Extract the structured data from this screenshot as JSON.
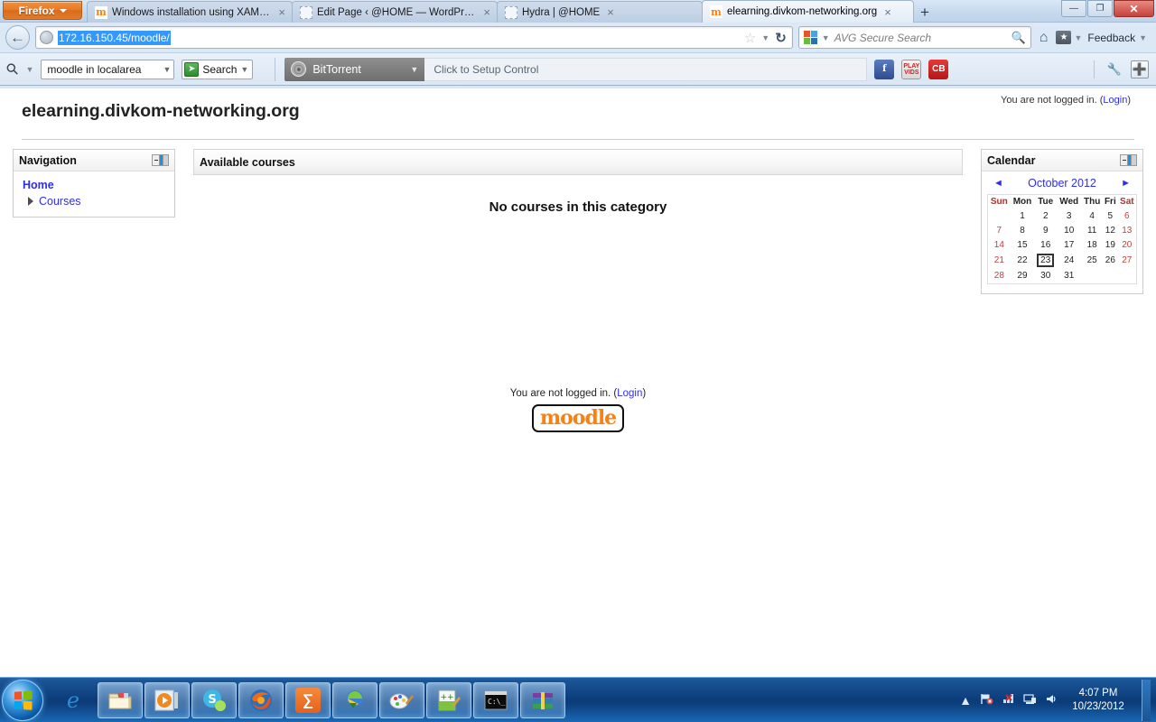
{
  "browser": {
    "app_button": "Firefox",
    "tabs": [
      {
        "label": "Windows installation using XAMPP - ...",
        "favicon": "moodle-favicon",
        "active": false,
        "close": "×"
      },
      {
        "label": "Edit Page ‹ @HOME — WordPress",
        "favicon": "blank-favicon",
        "active": false,
        "close": "×"
      },
      {
        "label": "Hydra | @HOME",
        "favicon": "blank-favicon",
        "active": false,
        "close": "×"
      },
      {
        "label": "elearning.divkom-networking.org",
        "favicon": "moodle-favicon",
        "active": true,
        "close": "×"
      }
    ],
    "new_tab_label": "+",
    "window_controls": {
      "minimize": "—",
      "restore": "❐",
      "close": "✕"
    },
    "url": "172.16.150.45/moodle/",
    "url_selected": true,
    "search": {
      "placeholder": "AVG Secure Search",
      "engine_icon": "avg-icon",
      "go_icon": "search-icon"
    },
    "home_label": "Home",
    "feedback_label": "Feedback",
    "back_icon": "back-arrow-icon",
    "reload_icon": "reload-icon",
    "star_icon": "bookmark-star-icon"
  },
  "addon_toolbar": {
    "avg_search_value": "moodle in localarea",
    "avg_search_button": "Search",
    "bittorrent_label": "BitTorrent",
    "bittorrent_setup_text": "Click to Setup Control",
    "buttons": [
      {
        "name": "facebook-button",
        "label": "f",
        "color": "#3b5998"
      },
      {
        "name": "playvids-button",
        "label": "PLAY VIDS",
        "color": "#d42a2a"
      },
      {
        "name": "cb-button",
        "label": "CB",
        "color": "#cc1f1f"
      }
    ],
    "tools": [
      {
        "name": "wrench-icon",
        "glyph": "🔧"
      },
      {
        "name": "plus-box-icon",
        "glyph": "+"
      }
    ]
  },
  "page": {
    "site_title": "elearning.divkom-networking.org",
    "login_notice_prefix": "You are not logged in. (",
    "login_link": "Login",
    "login_notice_suffix": ")",
    "navigation_block": {
      "title": "Navigation",
      "home": "Home",
      "courses": "Courses"
    },
    "main": {
      "courses_header": "Available courses",
      "no_courses_text": "No courses in this category"
    },
    "calendar_block": {
      "title": "Calendar",
      "prev_arrow": "◄",
      "next_arrow": "►",
      "month_label": "October 2012",
      "weekdays": [
        "Sun",
        "Mon",
        "Tue",
        "Wed",
        "Thu",
        "Fri",
        "Sat"
      ],
      "weeks": [
        [
          "",
          "1",
          "2",
          "3",
          "4",
          "5",
          "6"
        ],
        [
          "7",
          "8",
          "9",
          "10",
          "11",
          "12",
          "13"
        ],
        [
          "14",
          "15",
          "16",
          "17",
          "18",
          "19",
          "20"
        ],
        [
          "21",
          "22",
          "23",
          "24",
          "25",
          "26",
          "27"
        ],
        [
          "28",
          "29",
          "30",
          "31",
          "",
          "",
          ""
        ]
      ],
      "today": "23"
    },
    "footer": {
      "login_notice_prefix": "You are not logged in. (",
      "login_link": "Login",
      "login_notice_suffix": ")",
      "logo_text": "moodle"
    },
    "colors": {
      "link": "#2d2df1",
      "moodle_orange": "#f98012",
      "weekend": "#c04040"
    }
  },
  "taskbar": {
    "start_label": "Start",
    "items": [
      {
        "name": "taskbar-item-internet-explorer",
        "icon": "internet-explorer-icon",
        "open": false
      },
      {
        "name": "taskbar-item-explorer",
        "icon": "windows-explorer-icon",
        "open": true
      },
      {
        "name": "taskbar-item-media-player",
        "icon": "windows-media-player-icon",
        "open": true
      },
      {
        "name": "taskbar-item-skype",
        "icon": "skype-icon",
        "open": true
      },
      {
        "name": "taskbar-item-firefox",
        "icon": "firefox-icon",
        "open": true
      },
      {
        "name": "taskbar-item-xampp",
        "icon": "xampp-icon",
        "open": true
      },
      {
        "name": "taskbar-item-idm",
        "icon": "internet-download-manager-icon",
        "open": true
      },
      {
        "name": "taskbar-item-paint",
        "icon": "paint-icon",
        "open": true
      },
      {
        "name": "taskbar-item-notepadpp",
        "icon": "notepad-plus-plus-icon",
        "open": true
      },
      {
        "name": "taskbar-item-cmd",
        "icon": "command-prompt-icon",
        "open": true
      },
      {
        "name": "taskbar-item-winrar",
        "icon": "winrar-icon",
        "open": true
      }
    ],
    "tray": [
      {
        "name": "show-hidden-icons-button",
        "glyph": "▲"
      },
      {
        "name": "action-center-icon",
        "glyph": "⚑"
      },
      {
        "name": "network-error-icon",
        "glyph": "✕"
      },
      {
        "name": "network-icon",
        "glyph": "▤"
      },
      {
        "name": "volume-icon",
        "glyph": "🔊"
      }
    ],
    "clock_time": "4:07 PM",
    "clock_date": "10/23/2012"
  }
}
